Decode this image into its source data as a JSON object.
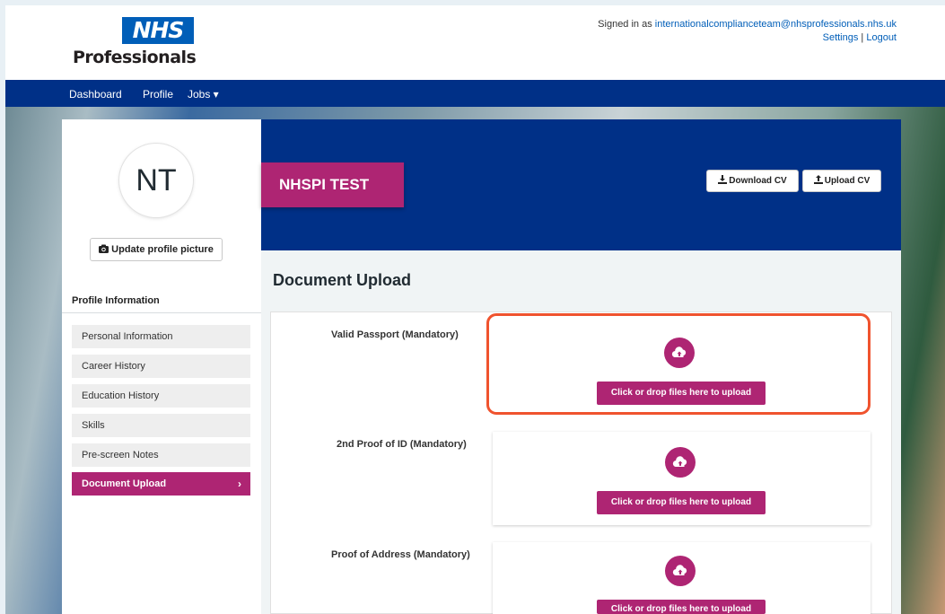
{
  "header": {
    "logo_mark": "NHS",
    "logo_text": "Professionals",
    "signed_in_prefix": "Signed in as ",
    "email": "internationalcomplianceteam@nhsprofessionals.nhs.uk",
    "settings_label": "Settings",
    "separator": "|",
    "logout_label": "Logout"
  },
  "nav": {
    "dashboard": "Dashboard",
    "profile": "Profile",
    "jobs": "Jobs ▾"
  },
  "sidebar": {
    "initials": "NT",
    "update_picture_label": "Update profile picture",
    "section_title": "Profile Information",
    "items": [
      {
        "label": "Personal Information"
      },
      {
        "label": "Career History"
      },
      {
        "label": "Education History"
      },
      {
        "label": "Skills"
      },
      {
        "label": "Pre-screen Notes"
      },
      {
        "label": "Document Upload",
        "active": true
      }
    ]
  },
  "profile": {
    "name": "NHSPI TEST",
    "download_cv": "Download CV",
    "upload_cv": "Upload CV"
  },
  "main": {
    "title": "Document Upload",
    "documents": [
      {
        "label": "Valid Passport (Mandatory)",
        "button": "Click or drop files here to upload"
      },
      {
        "label": "2nd Proof of ID (Mandatory)",
        "button": "Click or drop files here to upload"
      },
      {
        "label": "Proof of Address (Mandatory)",
        "button": "Click or drop files here to upload"
      }
    ]
  },
  "colors": {
    "nhs_blue": "#005eb8",
    "nav_blue": "#003087",
    "accent": "#ae2573",
    "highlight": "#f0532e"
  }
}
